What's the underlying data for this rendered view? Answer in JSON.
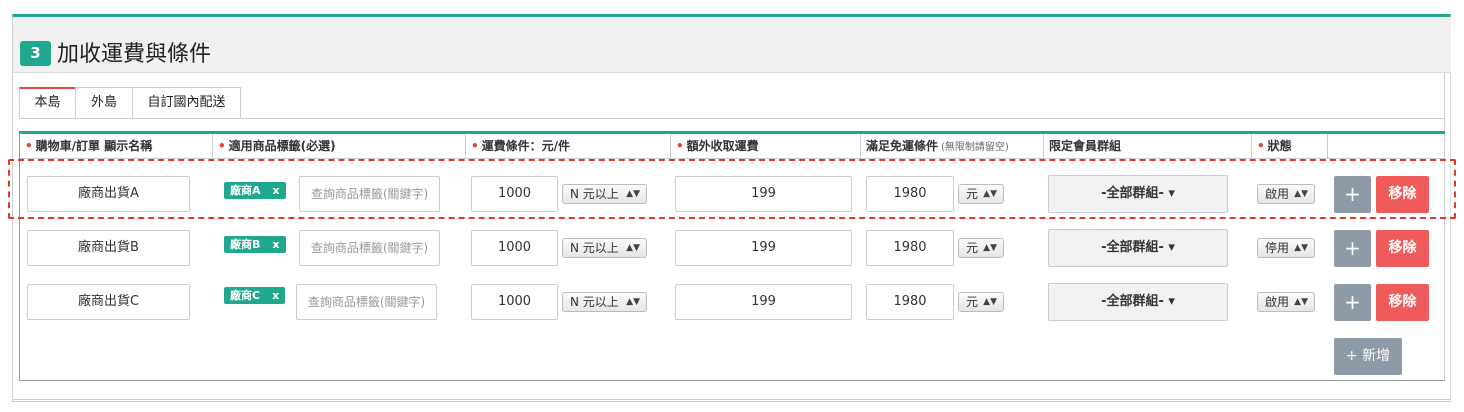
{
  "section": {
    "step": "3",
    "title": "加收運費與條件"
  },
  "tabs": [
    "本島",
    "外島",
    "自訂國內配送"
  ],
  "columns": {
    "display_name": "購物車/訂單 顯示名稱",
    "tags": "適用商品標籤(必選)",
    "condition": "運費條件：元/件",
    "extra_fee": "額外收取運費",
    "free_condition": "滿足免運條件",
    "free_condition_note": "(無限制請留空)",
    "member_group": "限定會員群組",
    "status": "狀態"
  },
  "required_mark": "•",
  "tag_search_placeholder": "查詢商品標籤(關鍵字)",
  "chip_remove": "x",
  "rows": [
    {
      "name": "廠商出貨A",
      "tag": "廠商A",
      "qty": "1000",
      "unit_select": "N 元以上",
      "fee": "199",
      "free": "1980",
      "free_unit": "元",
      "group": "-全部群組-",
      "status": "啟用",
      "plus": "+",
      "remove": "移除"
    },
    {
      "name": "廠商出貨B",
      "tag": "廠商B",
      "qty": "1000",
      "unit_select": "N 元以上",
      "fee": "199",
      "free": "1980",
      "free_unit": "元",
      "group": "-全部群組-",
      "status": "停用",
      "plus": "+",
      "remove": "移除"
    },
    {
      "name": "廠商出貨C",
      "tag": "廠商C",
      "qty": "1000",
      "unit_select": "N 元以上",
      "fee": "199",
      "free": "1980",
      "free_unit": "元",
      "group": "-全部群組-",
      "status": "啟用",
      "plus": "+",
      "remove": "移除"
    }
  ],
  "add_button": "+ 新增",
  "colors": {
    "accent": "#20a88e",
    "danger": "#ef5b5b",
    "gray_button": "#8e9ba6",
    "highlight": "#e03a2f"
  }
}
